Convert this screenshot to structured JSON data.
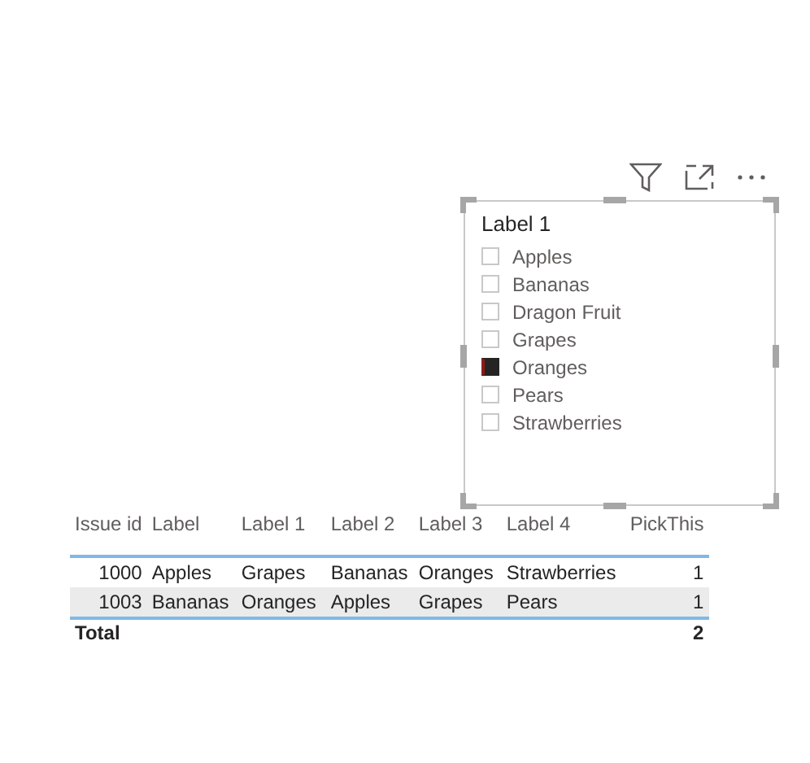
{
  "slicer": {
    "title": "Label 1",
    "items": [
      {
        "label": "Apples",
        "checked": false
      },
      {
        "label": "Bananas",
        "checked": false
      },
      {
        "label": "Dragon Fruit",
        "checked": false
      },
      {
        "label": "Grapes",
        "checked": false
      },
      {
        "label": "Oranges",
        "checked": true
      },
      {
        "label": "Pears",
        "checked": false
      },
      {
        "label": "Strawberries",
        "checked": false
      }
    ]
  },
  "table": {
    "columns": [
      {
        "label": "Issue id"
      },
      {
        "label": "Label"
      },
      {
        "label": "Label 1"
      },
      {
        "label": "Label 2"
      },
      {
        "label": "Label 3"
      },
      {
        "label": "Label 4"
      },
      {
        "label": "PickThis"
      }
    ],
    "rows": [
      {
        "cells": [
          "1000",
          "Apples",
          "Grapes",
          "Bananas",
          "Oranges",
          "Strawberries",
          "1"
        ],
        "shaded": false
      },
      {
        "cells": [
          "1003",
          "Bananas",
          "Oranges",
          "Apples",
          "Grapes",
          "Pears",
          "1"
        ],
        "shaded": true
      }
    ],
    "total": {
      "label": "Total",
      "value": "2"
    }
  }
}
